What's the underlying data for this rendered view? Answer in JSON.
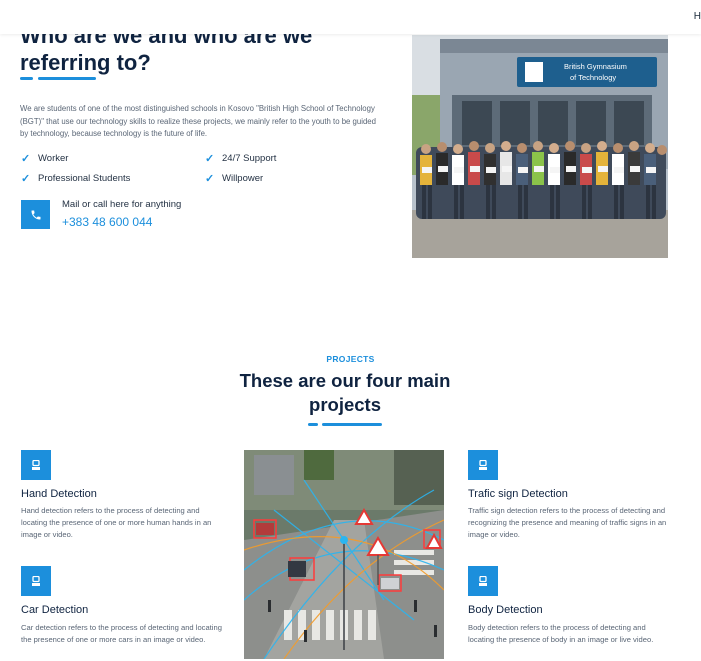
{
  "header": {
    "nav_edge_text": "H"
  },
  "about": {
    "title": "Who are we and who are we referring to?",
    "description": "We are students of one of the most distinguished schools in Kosovo \"British High School of Technology (BGT)\" that use our technology skills to realize these projects, we mainly refer to the youth to be guided by technology, because technology is the future of life.",
    "features": [
      "Worker",
      "24/7 Support",
      "Professional Students",
      "Willpower"
    ],
    "contact": {
      "label": "Mail or call here for anything",
      "phone": "+383 48 600 044"
    },
    "photo": {
      "sign_line1": "British Gymnasium",
      "sign_line2": "of Technology"
    }
  },
  "projects": {
    "tag": "PROJECTS",
    "title": "These are our four main projects",
    "items": [
      {
        "title": "Hand Detection",
        "description": "Hand detection refers to the process of detecting and locating the presence of one or more human hands in an image or video."
      },
      {
        "title": "Trafic sign Detection",
        "description": "Traffic sign detection refers to the process of detecting and recognizing the presence and meaning of traffic signs in an image or video."
      },
      {
        "title": "Car Detection",
        "description": "Car detection refers to the process of detecting and locating the presence of one or more cars in an image or video."
      },
      {
        "title": "Body Detection",
        "description": "Body detection refers to the process of detecting and locating the presence of body in an image or live video."
      }
    ]
  },
  "colors": {
    "accent": "#1c8fdc",
    "heading": "#0f2340",
    "body_text": "#5a6676"
  },
  "icons": {
    "check": "check-icon",
    "phone": "phone-icon",
    "project": "project-icon"
  }
}
